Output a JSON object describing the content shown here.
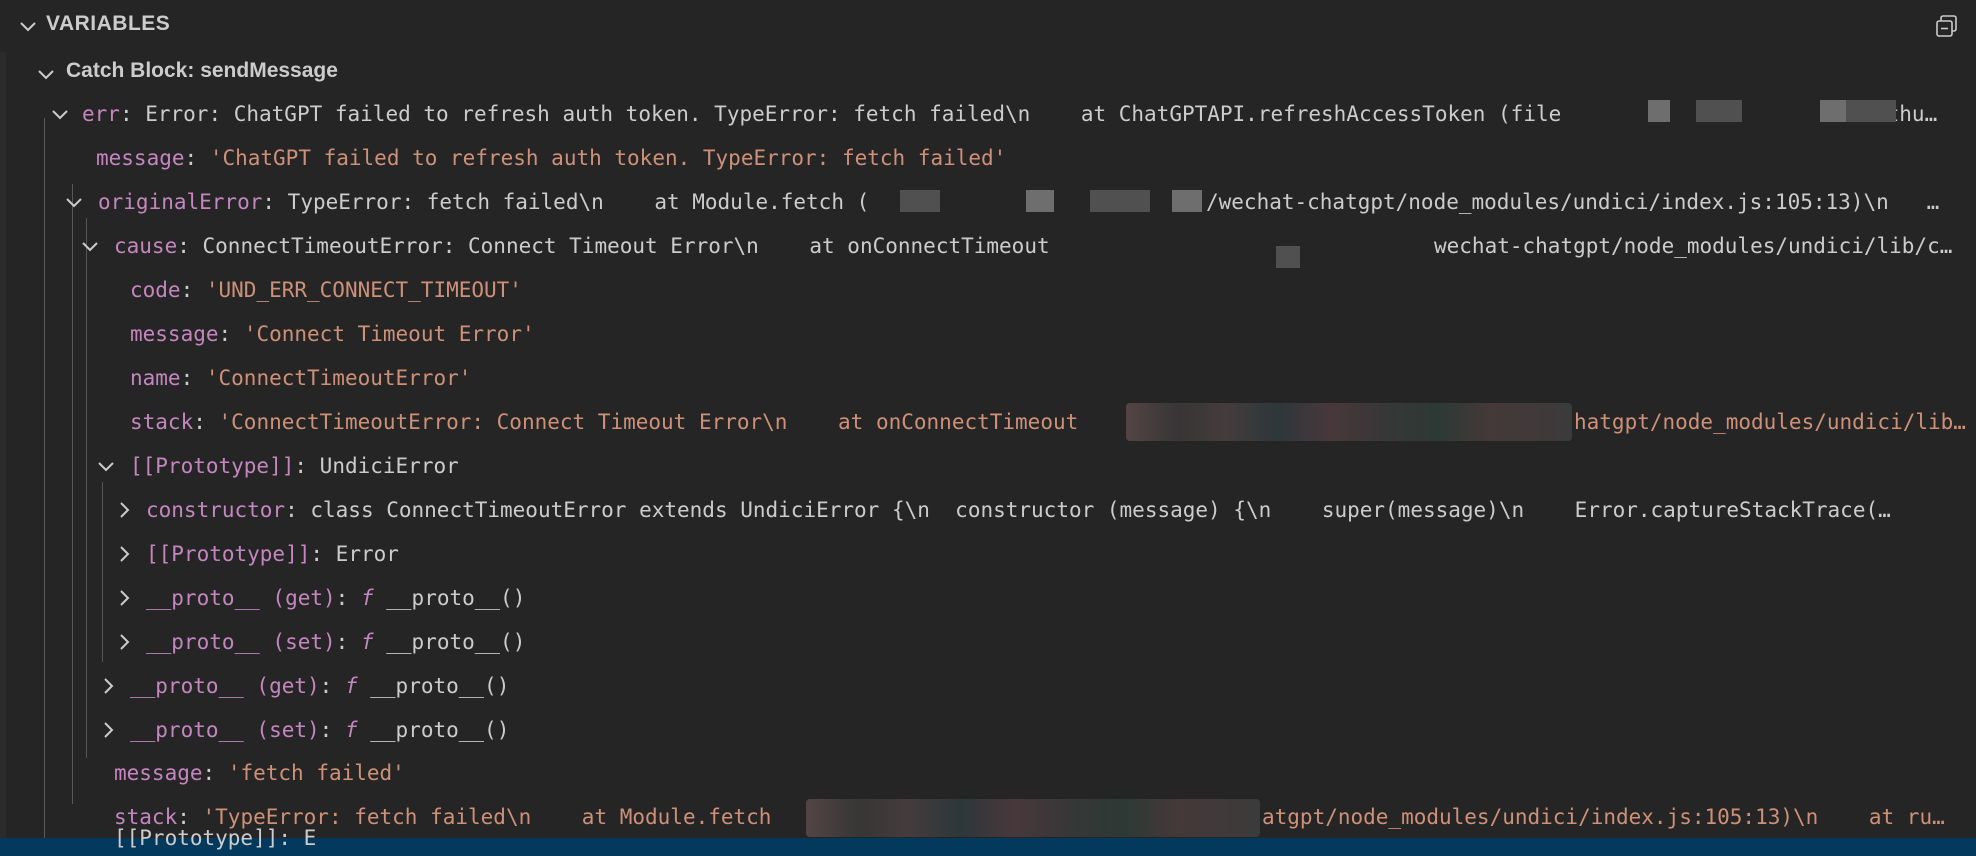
{
  "panel": {
    "title": "VARIABLES",
    "scope_label": "Catch Block: sendMessage"
  },
  "rows": {
    "err_key": "err",
    "err_val": "Error: ChatGPT failed to refresh auth token. TypeError: fetch failed\\n    at ChatGPTAPI.refreshAccessToken (file",
    "err_tail": "ithu…",
    "message_key": "message",
    "message_val": "'ChatGPT failed to refresh auth token. TypeError: fetch failed'",
    "orig_key": "originalError",
    "orig_val": "TypeError: fetch failed\\n    at Module.fetch (",
    "orig_tail": "/wechat-chatgpt/node_modules/undici/index.js:105:13)\\n   …",
    "cause_key": "cause",
    "cause_val": "ConnectTimeoutError: Connect Timeout Error\\n    at onConnectTimeout",
    "cause_tail": "wechat-chatgpt/node_modules/undici/lib/c…",
    "code_key": "code",
    "code_val": "'UND_ERR_CONNECT_TIMEOUT'",
    "cmsg_key": "message",
    "cmsg_val": "'Connect Timeout Error'",
    "name_key": "name",
    "name_val": "'ConnectTimeoutError'",
    "cstack_key": "stack",
    "cstack_val": "'ConnectTimeoutError: Connect Timeout Error\\n    at onConnectTimeout",
    "cstack_tail": "hatgpt/node_modules/undici/lib…",
    "proto1_key": "[[Prototype]]",
    "proto1_val": "UndiciError",
    "ctor_key": "constructor",
    "ctor_val": "class ConnectTimeoutError extends UndiciError {\\n  constructor (message) {\\n    super(message)\\n    Error.captureStackTrace(…",
    "proto2_key": "[[Prototype]]",
    "proto2_val": "Error",
    "pget1_key": "__proto__ (get)",
    "pset1_key": "__proto__ (set)",
    "pget2_key": "__proto__ (get)",
    "pset2_key": "__proto__ (set)",
    "f_symbol": "f",
    "proto_fn": "__proto__()",
    "omsg_key": "message",
    "omsg_val": "'fetch failed'",
    "ostack_key": "stack",
    "ostack_val": "'TypeError: fetch failed\\n    at Module.fetch",
    "ostack_tail": "atgpt/node_modules/undici/index.js:105:13)\\n    at ru…",
    "peek": "[[Prototype]]: E"
  },
  "colors": {
    "background": "#252526",
    "key": "#c586c0",
    "string": "#ce9178",
    "value": "#cccccc",
    "selection": "#04395e"
  },
  "icons": [
    "chevron-down-icon",
    "chevron-right-icon",
    "collapse-all-icon"
  ]
}
